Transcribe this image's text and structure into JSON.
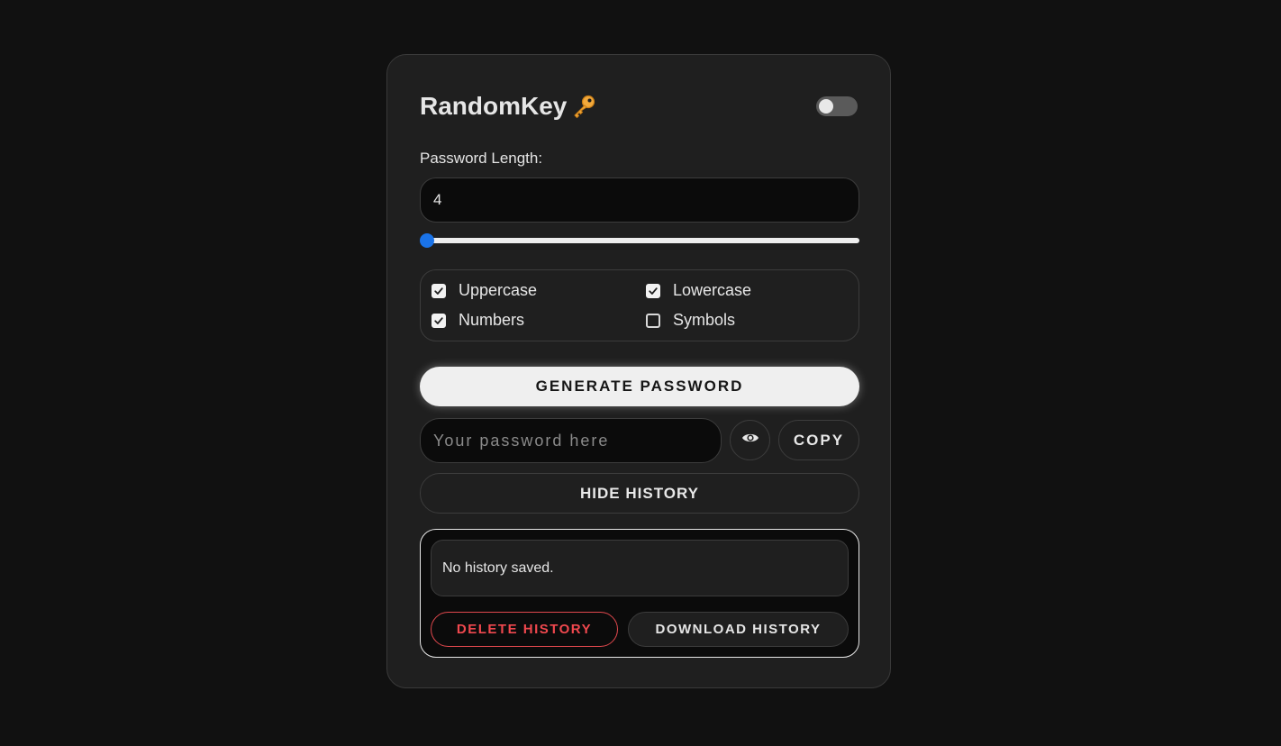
{
  "app": {
    "title": "RandomKey",
    "title_icon": "key-icon"
  },
  "theme_toggle": {
    "icon": "toggle-switch",
    "state": "off"
  },
  "length": {
    "label": "Password Length:",
    "value": "4",
    "slider_fraction": 0.0
  },
  "options": [
    {
      "label": "Uppercase",
      "checked": true
    },
    {
      "label": "Lowercase",
      "checked": true
    },
    {
      "label": "Numbers",
      "checked": true
    },
    {
      "label": "Symbols",
      "checked": false
    }
  ],
  "generate": {
    "label": "GENERATE PASSWORD"
  },
  "password": {
    "value": "",
    "placeholder": "Your password here",
    "reveal_icon": "eye-icon",
    "copy_label": "COPY"
  },
  "history": {
    "toggle_label": "HIDE HISTORY",
    "empty_text": "No history saved.",
    "delete_label": "DELETE HISTORY",
    "download_label": "DOWNLOAD HISTORY"
  },
  "colors": {
    "background": "#111111",
    "card": "#1f1f1f",
    "accent": "#1a73e8",
    "danger": "#f0484e"
  }
}
